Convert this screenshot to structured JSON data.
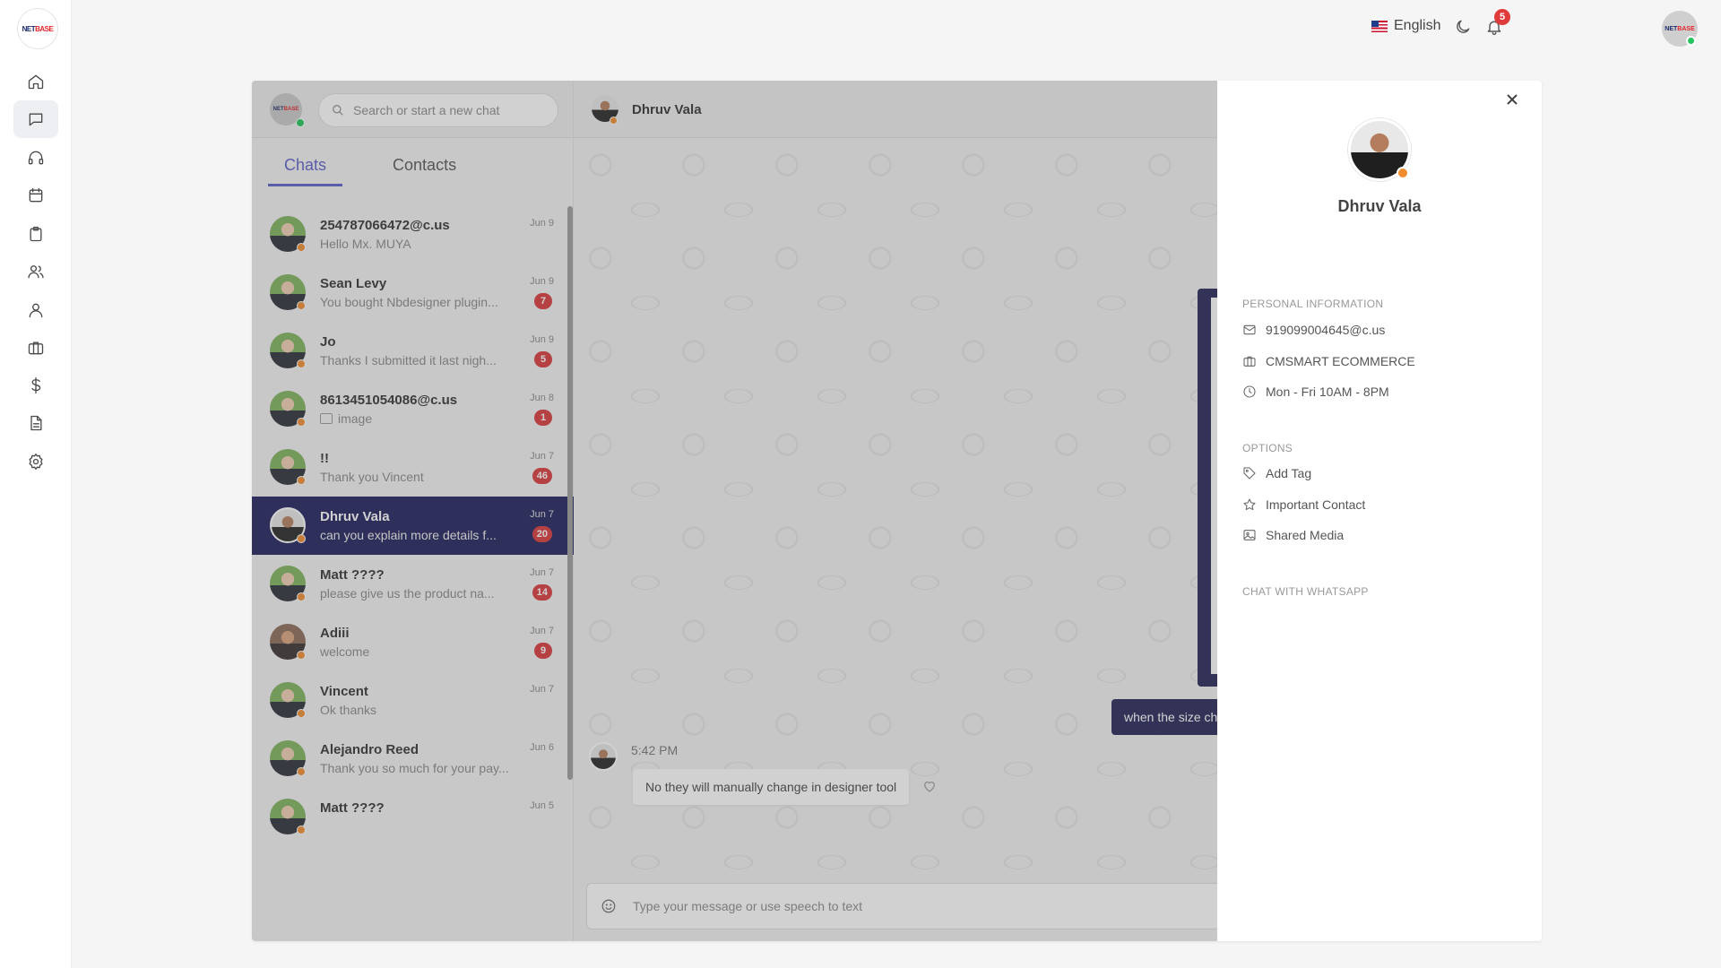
{
  "nav": {
    "logo_text_a": "NET",
    "logo_text_b": "BASE",
    "items": [
      {
        "icon": "home-icon",
        "active": false
      },
      {
        "icon": "chat-icon",
        "active": true
      },
      {
        "icon": "headset-icon",
        "active": false
      },
      {
        "icon": "calendar-icon",
        "active": false
      },
      {
        "icon": "clipboard-icon",
        "active": false
      },
      {
        "icon": "users-icon",
        "active": false
      },
      {
        "icon": "user-icon",
        "active": false
      },
      {
        "icon": "briefcase-icon",
        "active": false
      },
      {
        "icon": "dollar-icon",
        "active": false
      },
      {
        "icon": "document-icon",
        "active": false
      },
      {
        "icon": "gear-icon",
        "active": false
      }
    ]
  },
  "topbar": {
    "language": "English",
    "notification_count": "5"
  },
  "sidebar": {
    "search_placeholder": "Search or start a new chat",
    "tabs": [
      "Chats",
      "Contacts"
    ]
  },
  "chats": [
    {
      "name": "254787066472@c.us",
      "message": "Hello Mx. MUYA",
      "date": "Jun 9",
      "badge": ""
    },
    {
      "name": "Sean Levy",
      "message": "You bought Nbdesigner plugin...",
      "date": "Jun 9",
      "badge": "7"
    },
    {
      "name": "Jo",
      "message": "Thanks I submitted it last nigh...",
      "date": "Jun 9",
      "badge": "5"
    },
    {
      "name": "8613451054086@c.us",
      "message": "image",
      "date": "Jun 8",
      "badge": "1"
    },
    {
      "name": "!!",
      "message": "Thank you Vincent",
      "date": "Jun 7",
      "badge": "46"
    },
    {
      "name": "Dhruv Vala",
      "message": "can you explain more details f...",
      "date": "Jun 7",
      "badge": "20"
    },
    {
      "name": "Matt ????",
      "message": "please give us the product na...",
      "date": "Jun 7",
      "badge": "14"
    },
    {
      "name": "Adiii",
      "message": "welcome",
      "date": "Jun 7",
      "badge": "9"
    },
    {
      "name": "Vincent",
      "message": "Ok thanks",
      "date": "Jun 7",
      "badge": ""
    },
    {
      "name": "Alejandro Reed",
      "message": "Thank you so much for your pay...",
      "date": "Jun 6",
      "badge": ""
    },
    {
      "name": "Matt ????",
      "message": "",
      "date": "Jun 5",
      "badge": ""
    }
  ],
  "conversation": {
    "contact_name": "Dhruv Vala",
    "outgoing_text": "when the size cha",
    "incoming_time": "5:42 PM",
    "incoming_text": "No they will manually change in designer tool",
    "composer_placeholder": "Type your message or use speech to text"
  },
  "profile": {
    "name": "Dhruv Vala",
    "personal_heading": "PERSONAL INFORMATION",
    "email": "919099004645@c.us",
    "company": "CMSMART ECOMMERCE",
    "hours": "Mon - Fri 10AM - 8PM",
    "options_heading": "OPTIONS",
    "add_tag": "Add Tag",
    "important": "Important Contact",
    "shared_media": "Shared Media",
    "whatsapp_heading": "CHAT WITH WHATSAPP"
  },
  "colors": {
    "accent": "#5b5fc7",
    "selected_row": "#1e1f5c",
    "badge": "#d9383b",
    "status_away": "#f08c2e",
    "status_online": "#22c55e"
  }
}
